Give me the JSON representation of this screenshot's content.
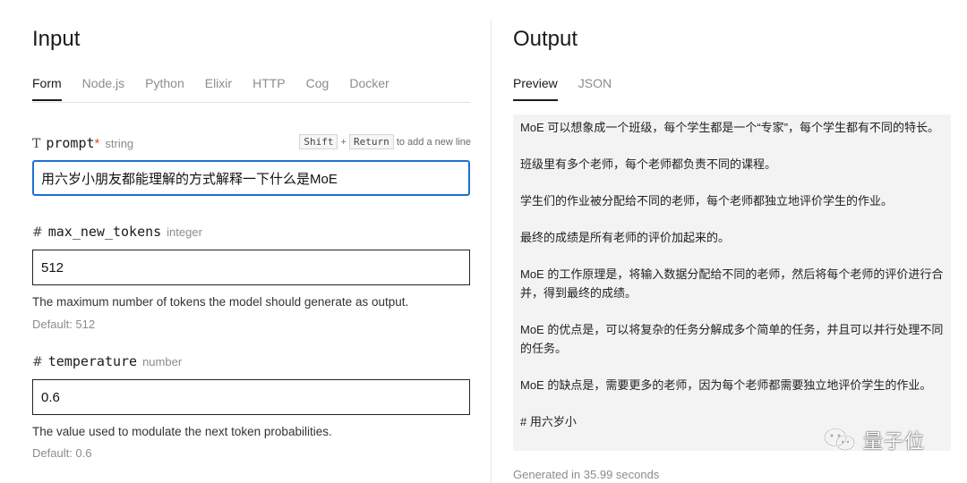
{
  "input": {
    "title": "Input",
    "tabs": [
      "Form",
      "Node.js",
      "Python",
      "Elixir",
      "HTTP",
      "Cog",
      "Docker"
    ],
    "active_tab": "Form",
    "fields": {
      "prompt": {
        "glyph": "T",
        "name": "prompt",
        "required_mark": "*",
        "type": "string",
        "hint_key1": "Shift",
        "hint_plus": "+",
        "hint_key2": "Return",
        "hint_text": "to add a new line",
        "value": "用六岁小朋友都能理解的方式解释一下什么是MoE"
      },
      "max_new_tokens": {
        "glyph": "#",
        "name": "max_new_tokens",
        "type": "integer",
        "value": "512",
        "description": "The maximum number of tokens the model should generate as output.",
        "default": "Default: 512"
      },
      "temperature": {
        "glyph": "#",
        "name": "temperature",
        "type": "number",
        "value": "0.6",
        "description": "The value used to modulate the next token probabilities.",
        "default": "Default: 0.6"
      }
    }
  },
  "output": {
    "title": "Output",
    "tabs": [
      "Preview",
      "JSON"
    ],
    "active_tab": "Preview",
    "paragraphs": [
      "MoE 可以想象成一个班级，每个学生都是一个“专家”，每个学生都有不同的特长。",
      "班级里有多个老师，每个老师都负责不同的课程。",
      "学生们的作业被分配给不同的老师，每个老师都独立地评价学生的作业。",
      "最终的成绩是所有老师的评价加起来的。",
      "MoE 的工作原理是，将输入数据分配给不同的老师，然后将每个老师的评价进行合并，得到最终的成绩。",
      "MoE 的优点是，可以将复杂的任务分解成多个简单的任务，并且可以并行处理不同的任务。",
      "MoE 的缺点是，需要更多的老师，因为每个老师都需要独立地评价学生的作业。",
      "# 用六岁小"
    ],
    "generated": "Generated in 35.99 seconds"
  },
  "watermark": {
    "text": "量子位",
    "icon": "wechat-icon"
  },
  "colors": {
    "focus": "#1f6fd1",
    "required": "#e0533d",
    "panel": "#f3f3f3"
  }
}
